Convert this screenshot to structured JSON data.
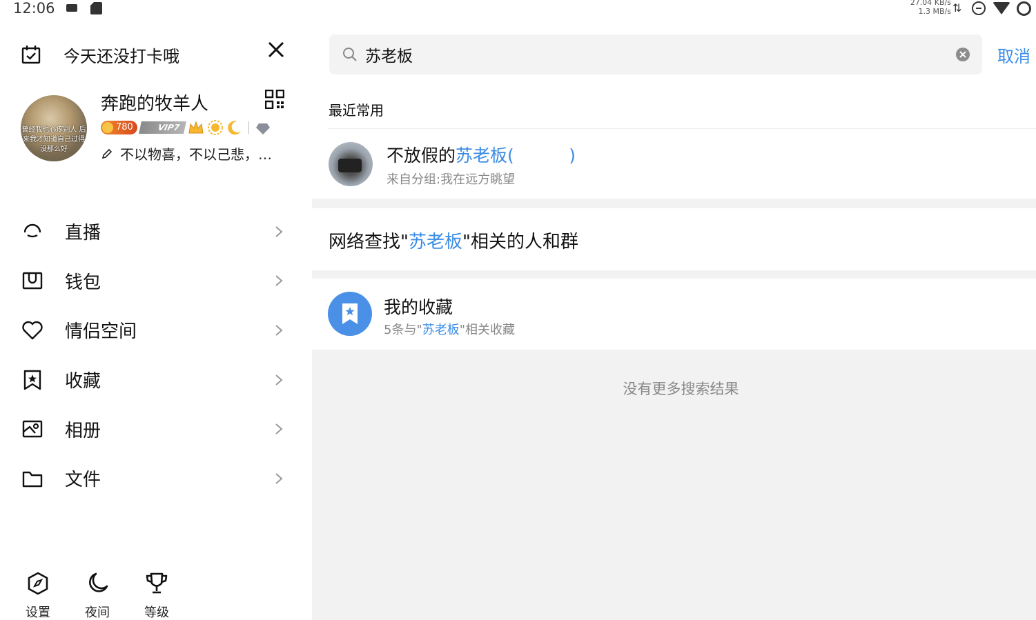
{
  "status_bar": {
    "time": "12:06",
    "speed_up": "27.04 KB/s",
    "speed_down": "1.3 MB/s",
    "icons": [
      "notification-icon",
      "sd-card-icon",
      "data-arrows-icon",
      "do-not-disturb-icon",
      "wifi-icon",
      "battery-icon"
    ]
  },
  "drawer": {
    "checkin_text": "今天还没打卡哦",
    "profile": {
      "nickname": "奔跑的牧羊人",
      "avatar_caption": "曾经我也心疼别人 后来我才知道自己过得没那么好",
      "level": "780",
      "vip": "VIP7",
      "signature": "不以物喜，不以己悲，…"
    },
    "menu": [
      {
        "label": "直播",
        "icon": "live-icon"
      },
      {
        "label": "钱包",
        "icon": "wallet-icon"
      },
      {
        "label": "情侣空间",
        "icon": "heart-icon"
      },
      {
        "label": "收藏",
        "icon": "favorite-icon"
      },
      {
        "label": "相册",
        "icon": "photo-album-icon"
      },
      {
        "label": "文件",
        "icon": "folder-icon"
      }
    ],
    "bottom": [
      {
        "label": "设置",
        "icon": "settings-icon"
      },
      {
        "label": "夜间",
        "icon": "night-mode-icon"
      },
      {
        "label": "等级",
        "icon": "trophy-icon"
      }
    ]
  },
  "search": {
    "query": "苏老板",
    "cancel_label": "取消",
    "recent_title": "最近常用",
    "contact": {
      "name_prefix": "不放假的",
      "name_match": "苏老板",
      "name_suffix": "(          )",
      "group": "来自分组:我在远方眺望"
    },
    "web_search": {
      "prefix": "网络查找\"",
      "match": "苏老板",
      "suffix": "\"相关的人和群"
    },
    "favorites": {
      "title": "我的收藏",
      "sub_prefix": "5条与\"",
      "sub_match": "苏老板",
      "sub_suffix": "\"相关收藏"
    },
    "no_more": "没有更多搜索结果"
  },
  "colors": {
    "accent": "#3a8ce6",
    "favorite_icon_bg": "#4a90e6",
    "panel_bg": "#f2f2f2"
  }
}
